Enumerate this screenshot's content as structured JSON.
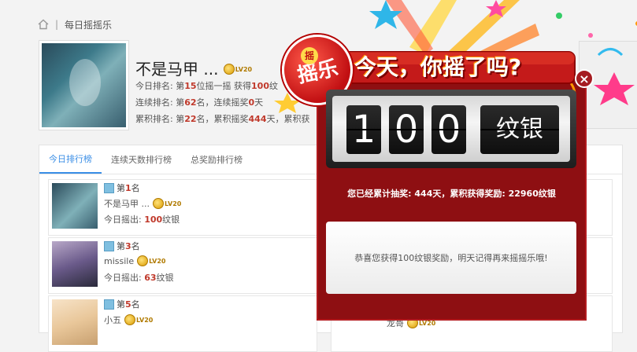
{
  "breadcrumb": {
    "home_icon": "home-icon",
    "current": "每日摇摇乐"
  },
  "profile": {
    "username": "不是马甲 ...",
    "level_badge": "LV20",
    "today_rank_prefix": "今日排名: 第",
    "today_rank": "15",
    "today_rank_suffix": "位摇一摇 获得",
    "today_coins": "100",
    "today_coins_suffix": "纹",
    "streak_rank_prefix": "连续排名: 第",
    "streak_rank": "62",
    "streak_rank_mid": "名，连续摇奖",
    "streak_days": "0",
    "streak_days_suffix": "天",
    "total_rank_prefix": "累积排名: 第",
    "total_rank": "22",
    "total_rank_mid": "名，累积摇奖",
    "total_days": "444",
    "total_days_suffix": "天，累积获"
  },
  "tabs": [
    {
      "label": "今日排行榜",
      "active": true
    },
    {
      "label": "连续天数排行榜",
      "active": false
    },
    {
      "label": "总奖励排行榜",
      "active": false
    }
  ],
  "rank_list": [
    {
      "rank_prefix": "第",
      "rank": "1",
      "rank_suffix": "名",
      "name": "不是马甲 ...",
      "badge": "LV20",
      "out_prefix": "今日摇出: ",
      "out_value": "100",
      "out_suffix": "纹银"
    },
    {
      "rank_prefix": "第",
      "rank": "3",
      "rank_suffix": "名",
      "name": "missile",
      "badge": "LV20",
      "out_prefix": "今日摇出: ",
      "out_value": "63",
      "out_suffix": "纹银"
    },
    {
      "rank_prefix": "第",
      "rank": "5",
      "rank_suffix": "名",
      "name": "小五",
      "badge": "LV20",
      "out_prefix": "",
      "out_value": "",
      "out_suffix": ""
    }
  ],
  "right_list_partial": {
    "name": "龙哥",
    "badge": "LV20"
  },
  "popup": {
    "banner_title": "今天，你摇了吗?",
    "banner_badge": "摇乐",
    "banner_badge_small": "摇",
    "close_symbol": "×",
    "digits": [
      "1",
      "0",
      "0"
    ],
    "unit": "纹银",
    "summary": "您已经累计抽奖: 444天，累积获得奖励: 22960纹银",
    "message": "恭喜您获得100纹银奖励，明天记得再来摇摇乐哦!"
  },
  "colors": {
    "accent": "#3a8ee6",
    "popup_bg": "#8e0f12",
    "highlight": "#c0392b"
  }
}
